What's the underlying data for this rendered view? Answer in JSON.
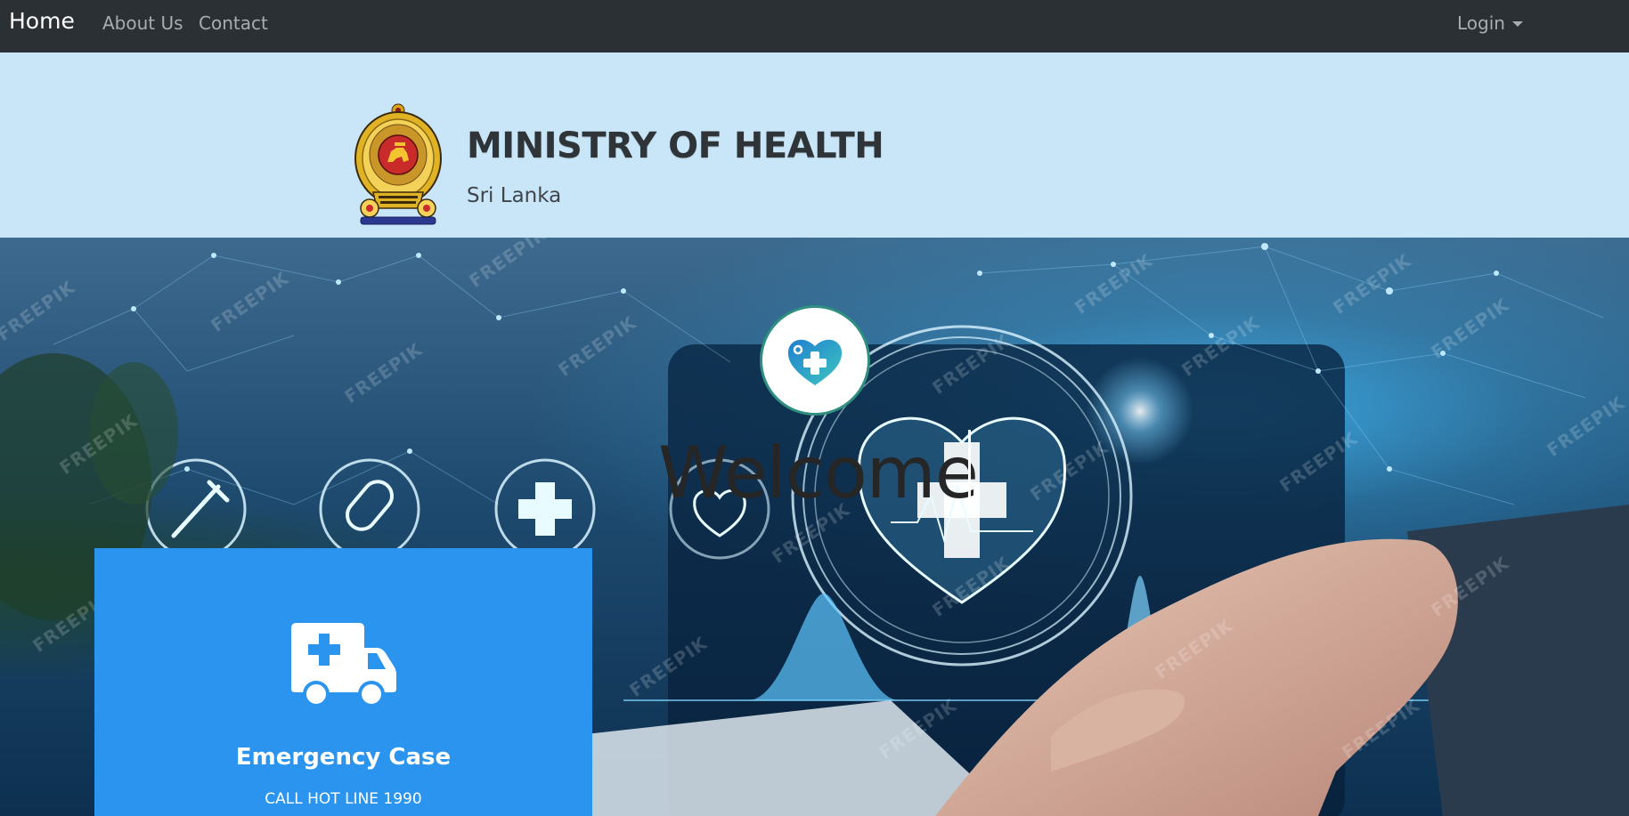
{
  "navbar": {
    "brand": "Home",
    "links": [
      "About Us",
      "Contact"
    ],
    "login_label": "Login"
  },
  "header": {
    "title": "MINISTRY OF HEALTH",
    "subtitle": "Sri Lanka"
  },
  "hero": {
    "welcome_text": "Welcome",
    "watermark_text": "FREEPIK"
  },
  "emergency_card": {
    "title": "Emergency Case",
    "subtitle": "CALL HOT LINE 1990",
    "color": "#2a94ee"
  },
  "colors": {
    "navbar_bg": "#2b3035",
    "header_bg": "#c8e6f8",
    "logo_border": "#2f8f80",
    "heart_gradient_start": "#1f7fd0",
    "heart_gradient_end": "#3fc7c0"
  },
  "icons": {
    "emblem": "sri-lanka-emblem-icon",
    "logo": "heart-plus-icon",
    "card": "ambulance-icon",
    "dropdown": "caret-down-icon"
  }
}
